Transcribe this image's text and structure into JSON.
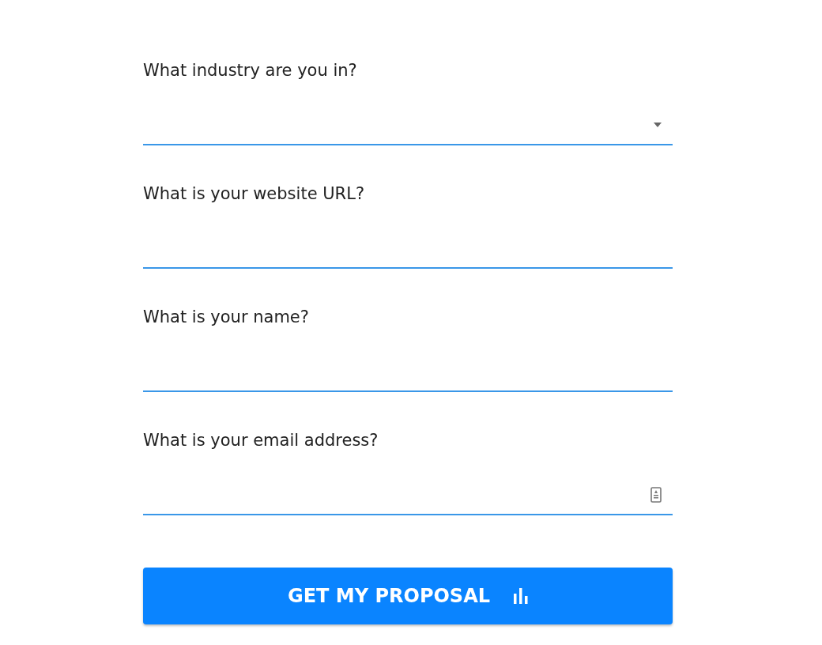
{
  "fields": [
    {
      "label": "What industry are you in?",
      "kind": "select"
    },
    {
      "label": "What is your website URL?",
      "kind": "text"
    },
    {
      "label": "What is your name?",
      "kind": "text"
    },
    {
      "label": "What is your email address?",
      "kind": "autofill"
    }
  ],
  "submit": {
    "label": "GET MY PROPOSAL"
  }
}
